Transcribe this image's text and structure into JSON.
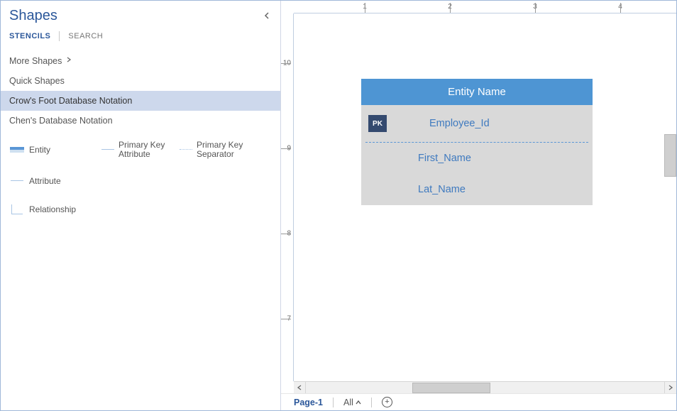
{
  "sidebar": {
    "title": "Shapes",
    "tabs": {
      "stencils": "STENCILS",
      "search": "SEARCH"
    },
    "categories": {
      "more": "More Shapes",
      "quick": "Quick Shapes",
      "crow": "Crow's Foot Database Notation",
      "chen": "Chen's Database Notation"
    },
    "stencils": {
      "entity": "Entity",
      "pk_attr": "Primary Key Attribute",
      "pk_sep": "Primary Key Separator",
      "attribute": "Attribute",
      "relationship": "Relationship"
    }
  },
  "ruler": {
    "h_labels": [
      "1",
      "2",
      "3",
      "4"
    ],
    "v_labels": [
      "10",
      "9",
      "8",
      "7"
    ]
  },
  "entity": {
    "header": "Entity Name",
    "pk_badge": "PK",
    "rows": {
      "pk": "Employee_Id",
      "r1": "First_Name",
      "r2": "Lat_Name"
    }
  },
  "page_tabs": {
    "page1": "Page-1",
    "all": "All"
  }
}
